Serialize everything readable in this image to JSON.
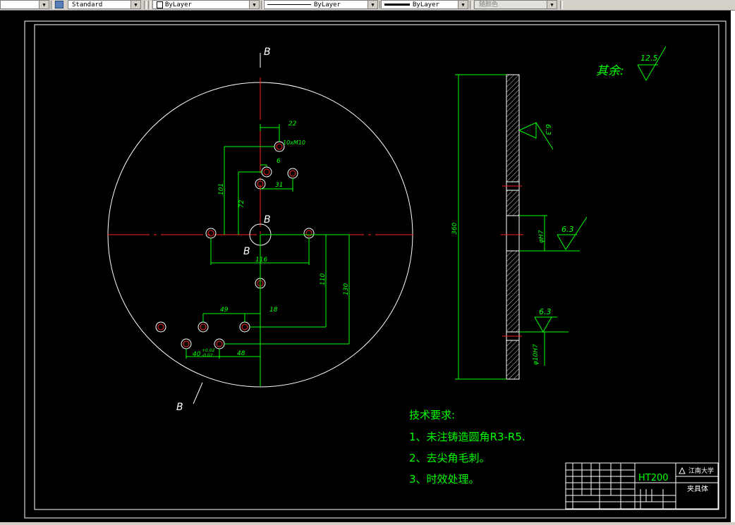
{
  "toolbar": {
    "text_style": "Standard",
    "layer": "ByLayer",
    "linetype": "ByLayer",
    "lineweight": "ByLayer",
    "color": "随颜色"
  },
  "drawing": {
    "section_label": "B",
    "dims": {
      "d22": "22",
      "holes_note": "10xM10",
      "d6": "6",
      "d101": "101",
      "d31": "31",
      "d72": "72",
      "d116": "116",
      "d110": "110",
      "d130": "130",
      "d49": "49",
      "d18": "18",
      "d40": "40",
      "tol_upper": "+0.02",
      "tol_lower": "-0.02",
      "d48": "48",
      "d360": "360",
      "bore": "φH7",
      "hole10": "φ10H7"
    },
    "roughness": {
      "others_label": "其余:",
      "others_value": "12.5",
      "r1": "6.3",
      "r2": "6.3",
      "r3": "6.3"
    },
    "tech_req": {
      "title": "技术要求:",
      "line1": "1、未注铸造圆角R3-R5.",
      "line2": "2、去尖角毛刺。",
      "line3": "3、时效处理。"
    },
    "title_block": {
      "material": "HT200",
      "school": "江南大学",
      "part_name": "夹具体"
    }
  }
}
